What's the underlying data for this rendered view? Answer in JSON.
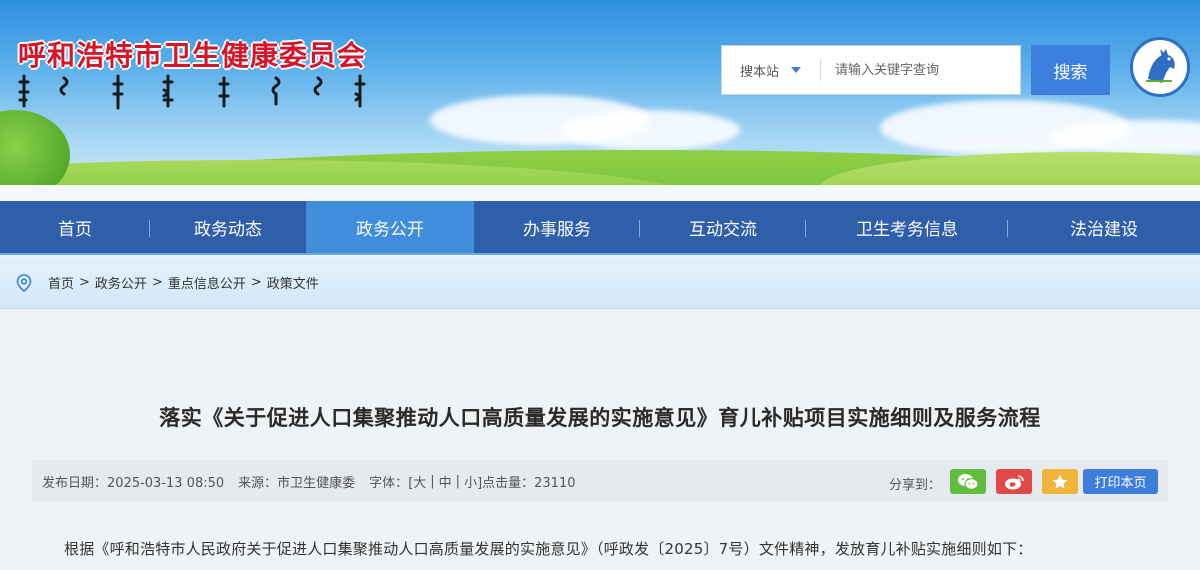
{
  "header": {
    "site_title": "呼和浩特市卫生健康委员会",
    "logo_script": "mongolian-script-title",
    "emblem_icon": "horse-emblem-icon"
  },
  "search": {
    "scope_label": "搜本站",
    "placeholder": "请输入关键字查询",
    "button_label": "搜索"
  },
  "nav": {
    "items": [
      {
        "label": "首页"
      },
      {
        "label": "政务动态"
      },
      {
        "label": "政务公开",
        "active": true
      },
      {
        "label": "办事服务"
      },
      {
        "label": "互动交流"
      },
      {
        "label": "卫生考务信息"
      },
      {
        "label": "法治建设"
      }
    ]
  },
  "breadcrumb": {
    "icon": "location-pin-icon",
    "items": [
      "首页",
      "政务公开",
      "重点信息公开",
      "政策文件"
    ],
    "separator": ">"
  },
  "article": {
    "title": "落实《关于促进人口集聚推动人口高质量发展的实施意见》育儿补贴项目实施细则及服务流程",
    "meta": {
      "date_label": "发布日期：2025-03-13 08:50",
      "source_label": "来源：市卫生健康委",
      "font_label": "字体：",
      "font_large": "[大",
      "font_medium": "中",
      "font_small": "小]",
      "font_sep": "|",
      "hits_label": "点击量：23110"
    },
    "share": {
      "label": "分享到：",
      "wechat_icon": "wechat-icon",
      "weibo_icon": "weibo-icon",
      "favorite_icon": "star-icon",
      "print_label": "打印本页"
    },
    "first_paragraph": "根据《呼和浩特市人民政府关于促进人口集聚推动人口高质量发展的实施意见》（呼政发〔2025〕7号）文件精神，发放育儿补贴实施细则如下："
  },
  "colors": {
    "title_red": "#d4162a",
    "nav_blue": "#2f5fa9",
    "nav_active": "#3f8ddb",
    "button_blue": "#3c7fdc",
    "wechat_green": "#5fbf3c",
    "weibo_red": "#e0484a",
    "star_gold": "#efb53a"
  }
}
